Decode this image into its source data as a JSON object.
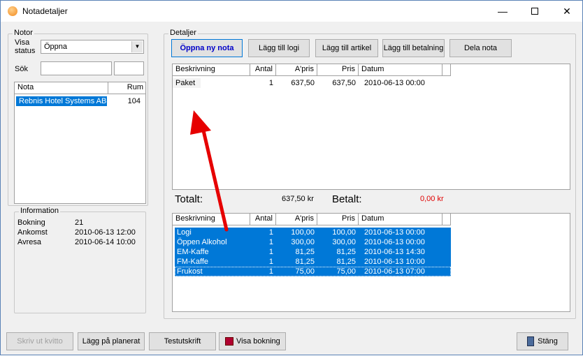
{
  "window": {
    "title": "Notadetaljer"
  },
  "notor": {
    "title": "Notor",
    "visa_status_label": "Visa\nstatus",
    "visa_status_value": "Öppna",
    "sok_label": "Sök",
    "columns": [
      "Nota",
      "Rum"
    ],
    "rows": [
      {
        "nota": "Rebnis Hotel Systems AB",
        "rum": "104"
      }
    ]
  },
  "information": {
    "title": "Information",
    "rows": [
      {
        "label": "Bokning",
        "value": "21"
      },
      {
        "label": "Ankomst",
        "value": "2010-06-13 12:00"
      },
      {
        "label": "Avresa",
        "value": "2010-06-14 10:00"
      }
    ]
  },
  "detaljer": {
    "title": "Detaljer",
    "buttons": {
      "open_new": "Öppna ny nota",
      "add_logi": "Lägg till logi",
      "add_artikel": "Lägg till artikel",
      "add_betalning": "Lägg till betalning",
      "dela": "Dela nota"
    },
    "columns": [
      "Beskrivning",
      "Antal",
      "A'pris",
      "Pris",
      "Datum"
    ],
    "upper_rows": [
      {
        "beskrivning": "Paket",
        "antal": "1",
        "apris": "637,50",
        "pris": "637,50",
        "datum": "2010-06-13 00:00"
      }
    ],
    "totalt_label": "Totalt:",
    "totalt_value": "637,50 kr",
    "betalt_label": "Betalt:",
    "betalt_value": "0,00 kr",
    "lower_rows": [
      {
        "beskrivning": "Logi",
        "antal": "1",
        "apris": "100,00",
        "pris": "100,00",
        "datum": "2010-06-13 00:00"
      },
      {
        "beskrivning": "Öppen Alkohol",
        "antal": "1",
        "apris": "300,00",
        "pris": "300,00",
        "datum": "2010-06-13 00:00"
      },
      {
        "beskrivning": "EM-Kaffe",
        "antal": "1",
        "apris": "81,25",
        "pris": "81,25",
        "datum": "2010-06-13 14:30"
      },
      {
        "beskrivning": "FM-Kaffe",
        "antal": "1",
        "apris": "81,25",
        "pris": "81,25",
        "datum": "2010-06-13 10:00"
      },
      {
        "beskrivning": "Frukost",
        "antal": "1",
        "apris": "75,00",
        "pris": "75,00",
        "datum": "2010-06-13 07:00"
      }
    ]
  },
  "bottom": {
    "skriv_ut": "Skriv ut kvitto",
    "lagg_pa": "Lägg på planerat",
    "testutskrift": "Testutskrift",
    "visa_bokning": "Visa bokning",
    "stang": "Stäng"
  },
  "colors": {
    "selection": "#0078d7",
    "annotation_arrow": "#e60000"
  }
}
